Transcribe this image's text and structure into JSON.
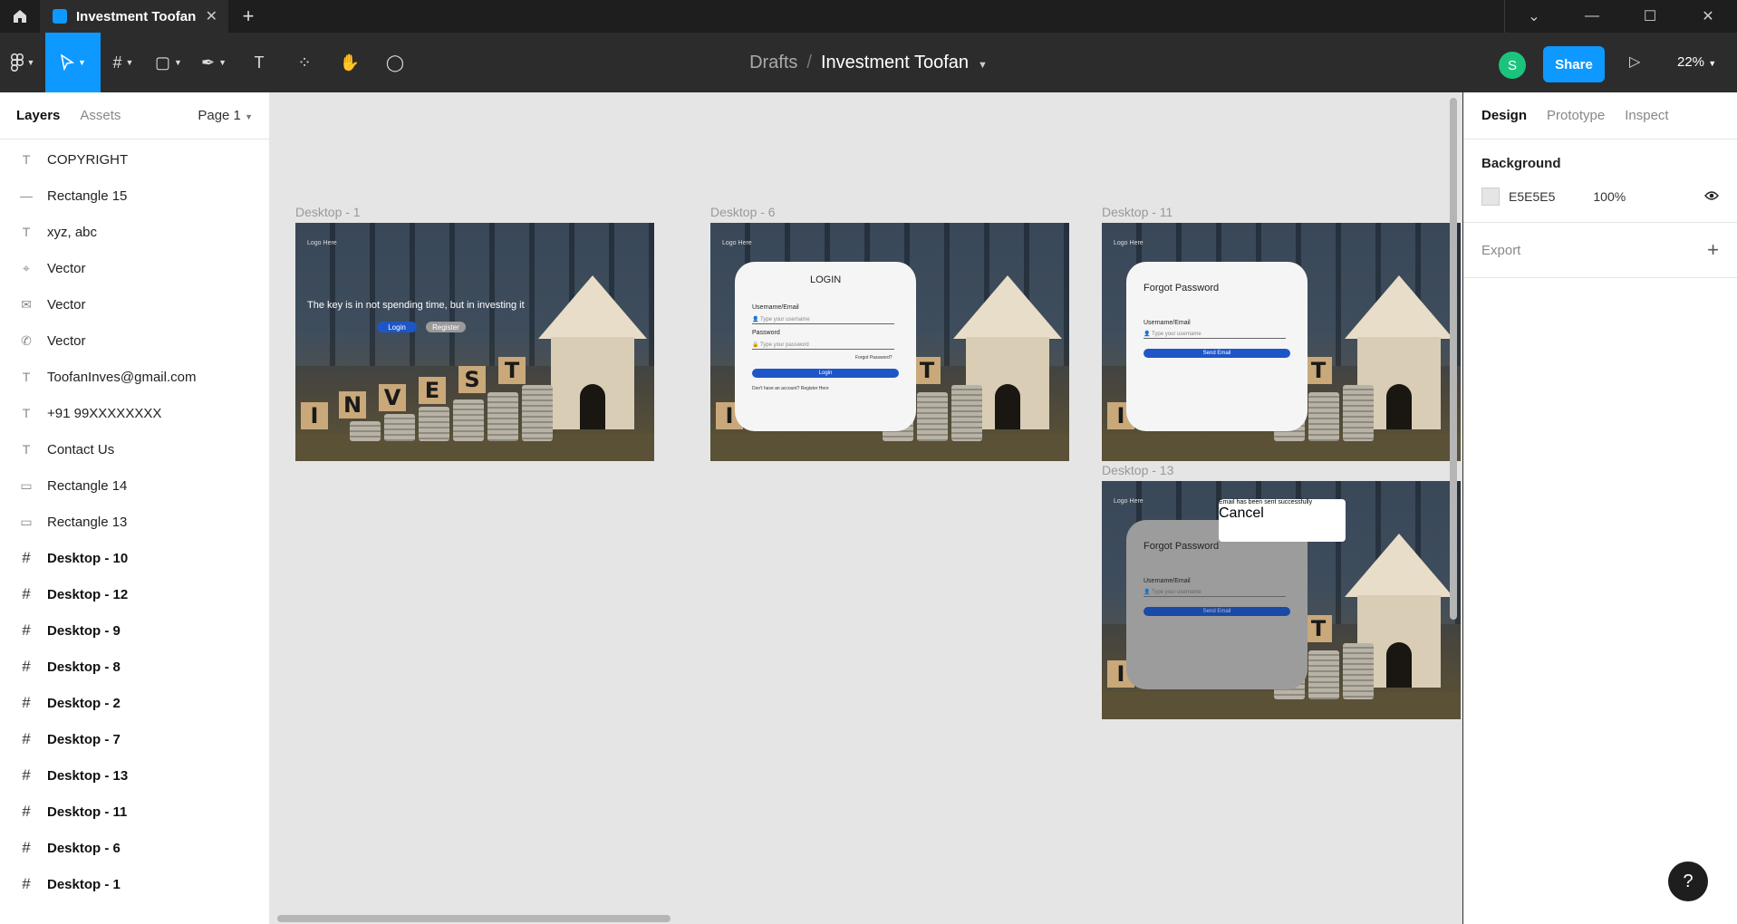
{
  "titlebar": {
    "tab_title": "Investment Toofan",
    "tab_close": "✕",
    "new_tab": "+",
    "controls": [
      "⌄",
      "—",
      "☐",
      "✕"
    ]
  },
  "toolbar": {
    "breadcrumb_drafts": "Drafts",
    "breadcrumb_sep": "/",
    "file_name": "Investment Toofan",
    "avatar_letter": "S",
    "share_label": "Share",
    "zoom": "22%"
  },
  "left_panel": {
    "tabs": [
      "Layers",
      "Assets"
    ],
    "page_selector": "Page 1",
    "layers": [
      {
        "icon": "T",
        "name": "COPYRIGHT"
      },
      {
        "icon": "—",
        "name": "Rectangle 15"
      },
      {
        "icon": "T",
        "name": "xyz, abc"
      },
      {
        "icon": "⌖",
        "name": "Vector"
      },
      {
        "icon": "✉",
        "name": "Vector"
      },
      {
        "icon": "✆",
        "name": "Vector"
      },
      {
        "icon": "T",
        "name": "ToofanInves@gmail.com"
      },
      {
        "icon": "T",
        "name": "+91 99XXXXXXXX"
      },
      {
        "icon": "T",
        "name": "Contact Us"
      },
      {
        "icon": "▭",
        "name": "Rectangle 14"
      },
      {
        "icon": "▭",
        "name": "Rectangle 13"
      },
      {
        "icon": "#",
        "name": "Desktop - 10"
      },
      {
        "icon": "#",
        "name": "Desktop - 12"
      },
      {
        "icon": "#",
        "name": "Desktop - 9"
      },
      {
        "icon": "#",
        "name": "Desktop - 8"
      },
      {
        "icon": "#",
        "name": "Desktop - 2"
      },
      {
        "icon": "#",
        "name": "Desktop - 7"
      },
      {
        "icon": "#",
        "name": "Desktop - 13"
      },
      {
        "icon": "#",
        "name": "Desktop - 11"
      },
      {
        "icon": "#",
        "name": "Desktop - 6"
      },
      {
        "icon": "#",
        "name": "Desktop - 1"
      }
    ]
  },
  "canvas": {
    "frames": {
      "d1": {
        "label": "Desktop - 1",
        "logo": "Logo Here",
        "tagline": "The key is in not spending time, but in investing it",
        "login_btn": "Login",
        "register_btn": "Register",
        "letters": [
          "I",
          "N",
          "V",
          "E",
          "S",
          "T"
        ]
      },
      "d6": {
        "label": "Desktop - 6",
        "logo": "Logo Here",
        "title": "LOGIN",
        "user_label": "Username/Email",
        "user_placeholder": "Type your username",
        "pass_label": "Password",
        "pass_placeholder": "Type your password",
        "forgot": "Forgot Password?",
        "login_btn": "Login",
        "register_prompt": "Don't have an account? Register Here",
        "letters": [
          "I",
          "T"
        ]
      },
      "d11": {
        "label": "Desktop - 11",
        "logo": "Logo Here",
        "title": "Forgot Password",
        "user_label": "Username/Email",
        "user_placeholder": "Type your username",
        "send_btn": "Send Email",
        "letters": [
          "I",
          "T"
        ]
      },
      "d13": {
        "label": "Desktop - 13",
        "logo": "Logo Here",
        "title": "Forgot Password",
        "user_label": "Username/Email",
        "user_placeholder": "Type your username",
        "send_btn": "Send Email",
        "toast_text": "Email  has been sent successfully",
        "toast_cancel": "Cancel",
        "letters": [
          "I",
          "T"
        ]
      }
    }
  },
  "right_panel": {
    "tabs": [
      "Design",
      "Prototype",
      "Inspect"
    ],
    "background_title": "Background",
    "bg_hex": "E5E5E5",
    "bg_opacity": "100%",
    "export_title": "Export",
    "export_add": "+"
  },
  "help": "?",
  "colors": {
    "accent": "#0d99ff",
    "canvas_bg": "#e5e5e5",
    "button_blue": "#1e56c8",
    "avatar": "#1bc47d"
  }
}
